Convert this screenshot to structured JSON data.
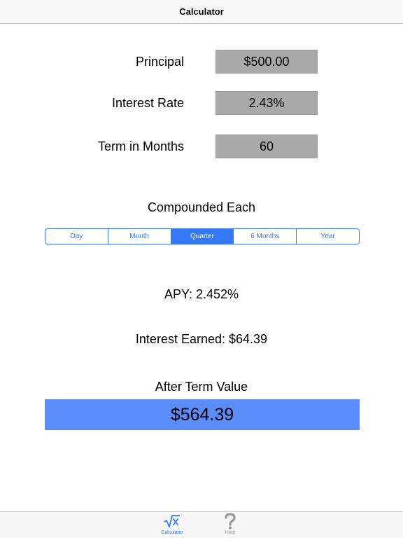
{
  "navbar": {
    "title": "Calculator"
  },
  "form": {
    "principal": {
      "label": "Principal",
      "value": "$500.00"
    },
    "interest_rate": {
      "label": "Interest Rate",
      "value": "2.43%"
    },
    "term": {
      "label": "Term in Months",
      "value": "60"
    }
  },
  "compounding": {
    "label": "Compounded Each",
    "options": [
      "Day",
      "Month",
      "Quarter",
      "6 Months",
      "Year"
    ],
    "selected": "Quarter"
  },
  "results": {
    "apy": "APY: 2.452%",
    "interest_earned": "Interest Earned: $64.39",
    "after_term_label": "After Term Value",
    "after_term_value": "$564.39"
  },
  "tabbar": {
    "items": [
      {
        "label": "Calculator",
        "icon": "square-root-x-icon",
        "active": true
      },
      {
        "label": "Help",
        "icon": "question-mark-icon",
        "active": false
      }
    ]
  },
  "colors": {
    "accent": "#3478f6",
    "field_bg": "#a9a9a9",
    "result_bg": "#5a8cfa"
  }
}
